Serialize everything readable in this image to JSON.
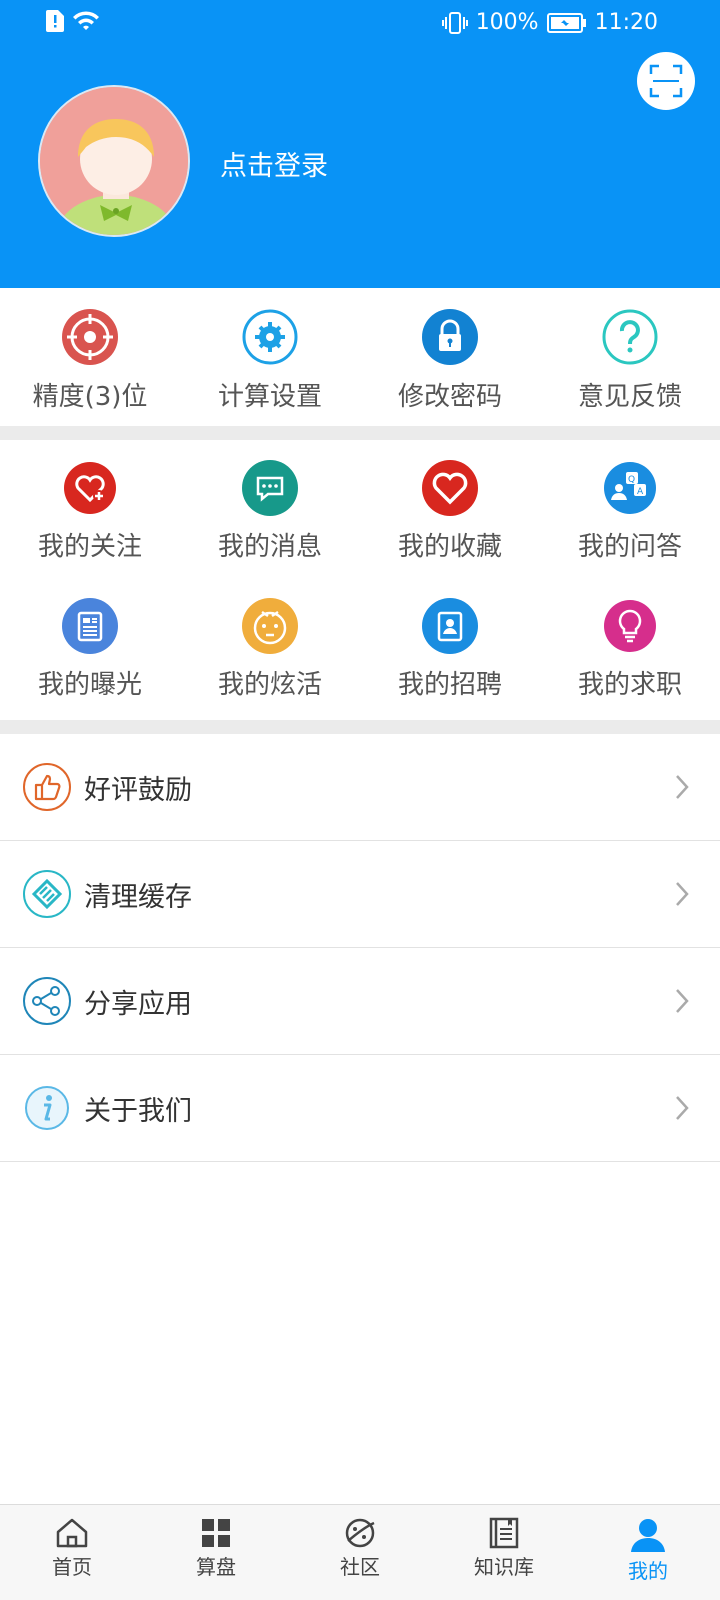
{
  "statusbar": {
    "battery": "100%",
    "time": "11:20"
  },
  "header": {
    "login_text": "点击登录",
    "background_color": "#0993f6"
  },
  "quick_actions": [
    {
      "label": "精度(3)位",
      "icon": "target-icon",
      "color": "#d9544f"
    },
    {
      "label": "计算设置",
      "icon": "gear-icon",
      "color": "#1da1e6"
    },
    {
      "label": "修改密码",
      "icon": "lock-icon",
      "color": "#1282d2"
    },
    {
      "label": "意见反馈",
      "icon": "question-icon",
      "color": "#2bc7c0"
    }
  ],
  "my_items": [
    {
      "label": "我的关注",
      "icon": "heart-plus-icon",
      "color": "#d8271f"
    },
    {
      "label": "我的消息",
      "icon": "message-icon",
      "color": "#17998a"
    },
    {
      "label": "我的收藏",
      "icon": "heart-icon",
      "color": "#d8271f"
    },
    {
      "label": "我的问答",
      "icon": "qa-icon",
      "color": "#1a8de0"
    },
    {
      "label": "我的曝光",
      "icon": "news-icon",
      "color": "#4a84dc"
    },
    {
      "label": "我的炫活",
      "icon": "face-icon",
      "color": "#f0ad3c"
    },
    {
      "label": "我的招聘",
      "icon": "badge-icon",
      "color": "#1a8de0"
    },
    {
      "label": "我的求职",
      "icon": "bulb-icon",
      "color": "#d62e8c"
    }
  ],
  "list": [
    {
      "label": "好评鼓励",
      "icon": "thumbs-up-icon",
      "color": "#e0662a"
    },
    {
      "label": "清理缓存",
      "icon": "broom-icon",
      "color": "#29b7c6"
    },
    {
      "label": "分享应用",
      "icon": "share-icon",
      "color": "#1f86b8"
    },
    {
      "label": "关于我们",
      "icon": "info-icon",
      "color": "#5ab8e6"
    }
  ],
  "bottom_nav": [
    {
      "label": "首页",
      "icon": "home-icon"
    },
    {
      "label": "算盘",
      "icon": "grid-icon"
    },
    {
      "label": "社区",
      "icon": "planet-icon"
    },
    {
      "label": "知识库",
      "icon": "book-icon"
    },
    {
      "label": "我的",
      "icon": "person-icon",
      "active": true
    }
  ]
}
